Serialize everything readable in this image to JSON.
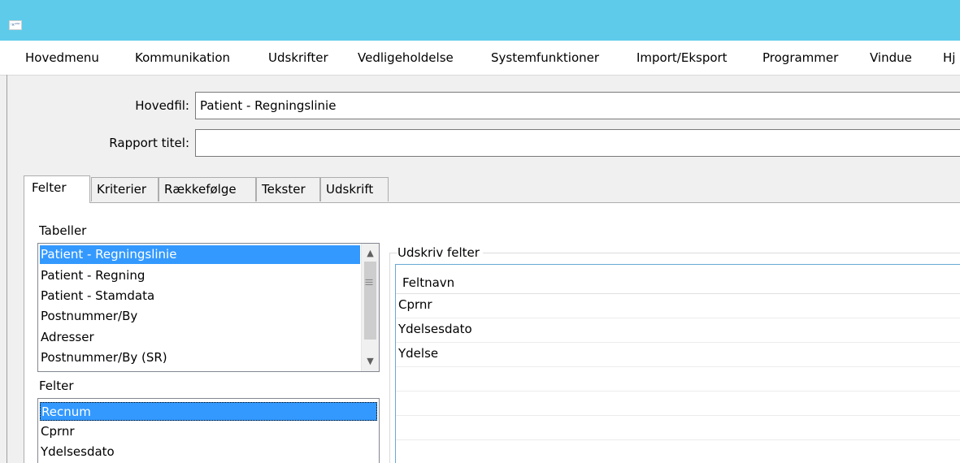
{
  "window": {
    "icon_text": "ꜞ×ᴬᵂᶜ"
  },
  "menu": {
    "items": [
      "Hovedmenu",
      "Kommunikation",
      "Udskrifter",
      "Vedligeholdelse",
      "Systemfunktioner",
      "Import/Eksport",
      "Programmer",
      "Vindue",
      "Hj"
    ]
  },
  "form": {
    "hovedfil_label": "Hovedfil:",
    "hovedfil_value": "Patient - Regningslinie",
    "rapport_label": "Rapport titel:",
    "rapport_value": ""
  },
  "tabs": [
    "Felter",
    "Kriterier",
    "Rækkefølge",
    "Tekster",
    "Udskrift"
  ],
  "active_tab": "Felter",
  "tabeller": {
    "label": "Tabeller",
    "items": [
      "Patient - Regningslinie",
      "Patient - Regning",
      "Patient - Stamdata",
      "Postnummer/By",
      "Adresser",
      "Postnummer/By (SR)"
    ],
    "selected": "Patient - Regningslinie"
  },
  "felter": {
    "label": "Felter",
    "items": [
      "Recnum",
      "Cprnr",
      "Ydelsesdato"
    ],
    "selected": "Recnum"
  },
  "udskriv": {
    "title": "Udskriv felter",
    "column_header": "Feltnavn",
    "rows": [
      "Cprnr",
      "Ydelsesdato",
      "Ydelse"
    ]
  },
  "colors": {
    "titlebar": "#5ecbea",
    "selection": "#3399ff"
  }
}
